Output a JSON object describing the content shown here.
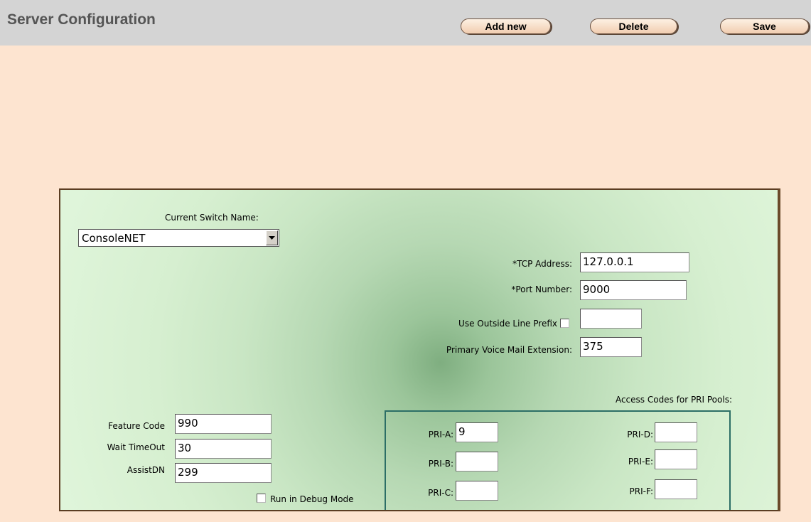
{
  "header": {
    "title": "Server Configuration",
    "buttons": {
      "add_new": "Add new",
      "delete": "Delete",
      "save": "Save"
    }
  },
  "form": {
    "switch_name_label": "Current Switch Name:",
    "switch_name_value": "ConsoleNET",
    "tcp_address_label": "*TCP Address:",
    "tcp_address_value": "127.0.0.1",
    "port_number_label": "*Port Number:",
    "port_number_value": "9000",
    "outside_line_prefix_label": "Use Outside Line Prefix",
    "outside_line_prefix_checked": false,
    "outside_line_prefix_value": "",
    "voice_mail_label": "Primary Voice Mail Extension:",
    "voice_mail_value": "375",
    "feature_code_label": "Feature Code",
    "feature_code_value": "990",
    "wait_timeout_label": "Wait TimeOut",
    "wait_timeout_value": "30",
    "assist_dn_label": "AssistDN",
    "assist_dn_value": "299",
    "debug_mode_label": "Run in Debug Mode",
    "debug_mode_checked": false
  },
  "pri": {
    "title": "Access Codes for PRI Pools:",
    "a_label": "PRI-A:",
    "a_value": "9",
    "b_label": "PRI-B:",
    "b_value": "",
    "c_label": "PRI-C:",
    "c_value": "",
    "d_label": "PRI-D:",
    "d_value": "",
    "e_label": "PRI-E:",
    "e_value": "",
    "f_label": "PRI-F:",
    "f_value": ""
  },
  "colors": {
    "header_bg": "#d4d4d4",
    "page_bg": "#fde4d0",
    "panel_center": "#7fae80",
    "panel_edge": "#dff5da",
    "pri_border": "#2c6e66"
  }
}
